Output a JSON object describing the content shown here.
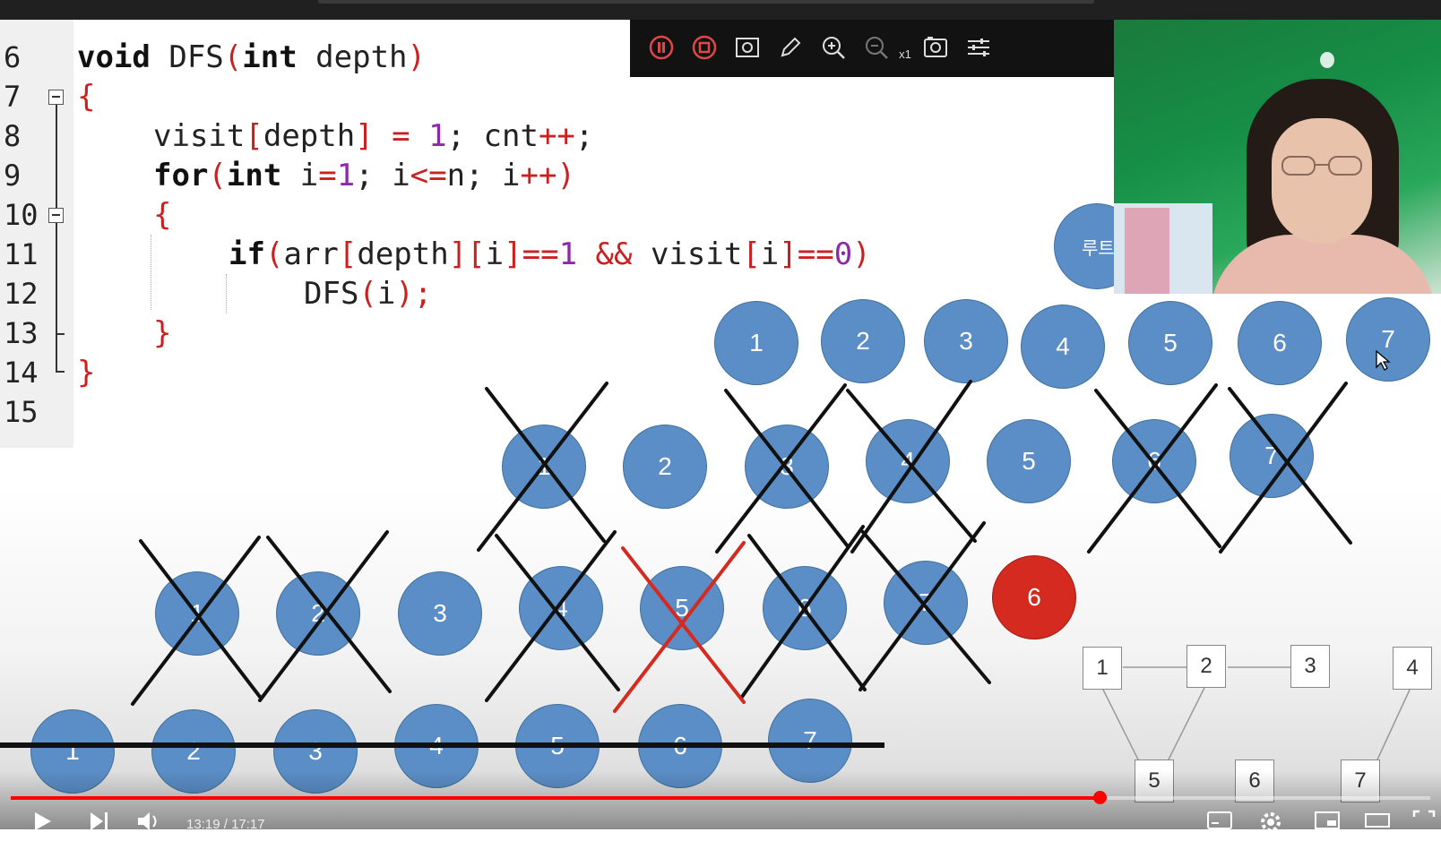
{
  "video": {
    "current_time": "13:19",
    "duration": "17:17",
    "progress_fraction": 0.767
  },
  "code": {
    "lines": [
      {
        "num": "6"
      },
      {
        "num": "7"
      },
      {
        "num": "8"
      },
      {
        "num": "9"
      },
      {
        "num": "10"
      },
      {
        "num": "11"
      },
      {
        "num": "12"
      },
      {
        "num": "13"
      },
      {
        "num": "14"
      },
      {
        "num": "15"
      }
    ],
    "tokens": {
      "l6_void": "void",
      "l6_name": " DFS",
      "l6_open": "(",
      "l6_int": "int",
      "l6_param": " depth",
      "l6_close": ")",
      "l7_brace": "{",
      "l8_a": "visit",
      "l8_b": "[",
      "l8_c": "depth",
      "l8_d": "]",
      "l8_e": " = ",
      "l8_f": "1",
      "l8_g": "; cnt",
      "l8_h": "++",
      "l8_i": ";",
      "l9_for": "for",
      "l9_open": "(",
      "l9_int": "int",
      "l9_a": " i",
      "l9_eq": "=",
      "l9_one": "1",
      "l9_b": "; i",
      "l9_le": "<=",
      "l9_c": "n; i",
      "l9_pp": "++",
      "l9_close": ")",
      "l10_brace": "{",
      "l11_if": "if",
      "l11_open": "(",
      "l11_a": "arr",
      "l11_b": "[",
      "l11_c": "depth",
      "l11_d": "][",
      "l11_e": "i",
      "l11_f": "]",
      "l11_g": "==",
      "l11_h": "1",
      "l11_and": " && ",
      "l11_i": "visit",
      "l11_j": "[",
      "l11_k": "i",
      "l11_l": "]",
      "l11_m": "==",
      "l11_n": "0",
      "l11_close": ")",
      "l12_a": "DFS",
      "l12_b": "(",
      "l12_c": "i",
      "l12_d": ");",
      "l13_brace": "}",
      "l14_brace": "}"
    }
  },
  "toolbar": {
    "items": [
      "pause-icon",
      "stop-icon",
      "screenshot-icon",
      "pencil-icon",
      "zoom-in-icon",
      "zoom-out-icon",
      "zoom-level",
      "camera-icon",
      "settings-sliders-icon"
    ],
    "zoom_label": "x1"
  },
  "tree": {
    "root_label": "루트",
    "level1": [
      "1",
      "2",
      "3",
      "4",
      "5",
      "6",
      "7"
    ],
    "level2": [
      "1",
      "2",
      "3",
      "4",
      "5",
      "6",
      "7"
    ],
    "level3": [
      "1",
      "2",
      "3",
      "4",
      "5",
      "6",
      "7",
      "6"
    ],
    "level4": [
      "1",
      "2",
      "3",
      "4",
      "5",
      "6",
      "7"
    ]
  },
  "graph": {
    "nodes": [
      "1",
      "2",
      "3",
      "4",
      "5",
      "6",
      "7"
    ]
  },
  "colors": {
    "node_blue": "#5b8ec6",
    "node_red": "#d42a20",
    "keyword_red": "#cc1f1f",
    "number_purple": "#8b2aa8",
    "progress_red": "#ff0000"
  }
}
